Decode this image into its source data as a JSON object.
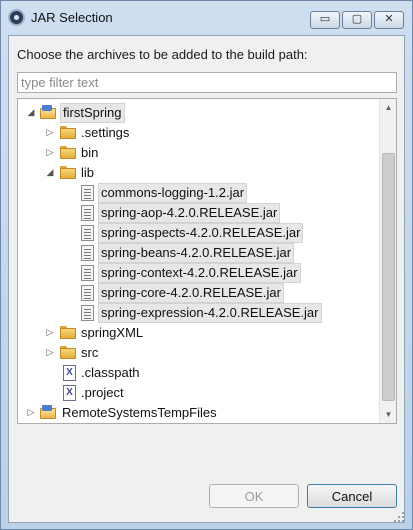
{
  "window": {
    "title": "JAR Selection",
    "controls": {
      "minimize": "▭",
      "maximize": "▢",
      "close": "✕"
    }
  },
  "prompt": "Choose the archives to be added to the build path:",
  "filter": {
    "value": "",
    "placeholder": "type filter text"
  },
  "tree": {
    "root": {
      "label": "firstSpring",
      "expanded": true,
      "icon": "project-folder-icon"
    },
    "children": {
      "settings": {
        "label": ".settings",
        "expanded": false
      },
      "bin": {
        "label": "bin",
        "expanded": false
      },
      "lib": {
        "label": "lib",
        "expanded": true
      },
      "jars": [
        "commons-logging-1.2.jar",
        "spring-aop-4.2.0.RELEASE.jar",
        "spring-aspects-4.2.0.RELEASE.jar",
        "spring-beans-4.2.0.RELEASE.jar",
        "spring-context-4.2.0.RELEASE.jar",
        "spring-core-4.2.0.RELEASE.jar",
        "spring-expression-4.2.0.RELEASE.jar"
      ],
      "springxml": {
        "label": "springXML",
        "expanded": false
      },
      "src": {
        "label": "src",
        "expanded": false
      },
      "classpath": {
        "label": ".classpath"
      },
      "project": {
        "label": ".project"
      }
    },
    "second_root": {
      "label": "RemoteSystemsTempFiles",
      "expanded": false
    }
  },
  "buttons": {
    "ok": "OK",
    "cancel": "Cancel"
  },
  "icons": {
    "expanded": "◢",
    "collapsed": "▷",
    "scroll_up": "▲",
    "scroll_down": "▼",
    "xml_file": "X"
  }
}
